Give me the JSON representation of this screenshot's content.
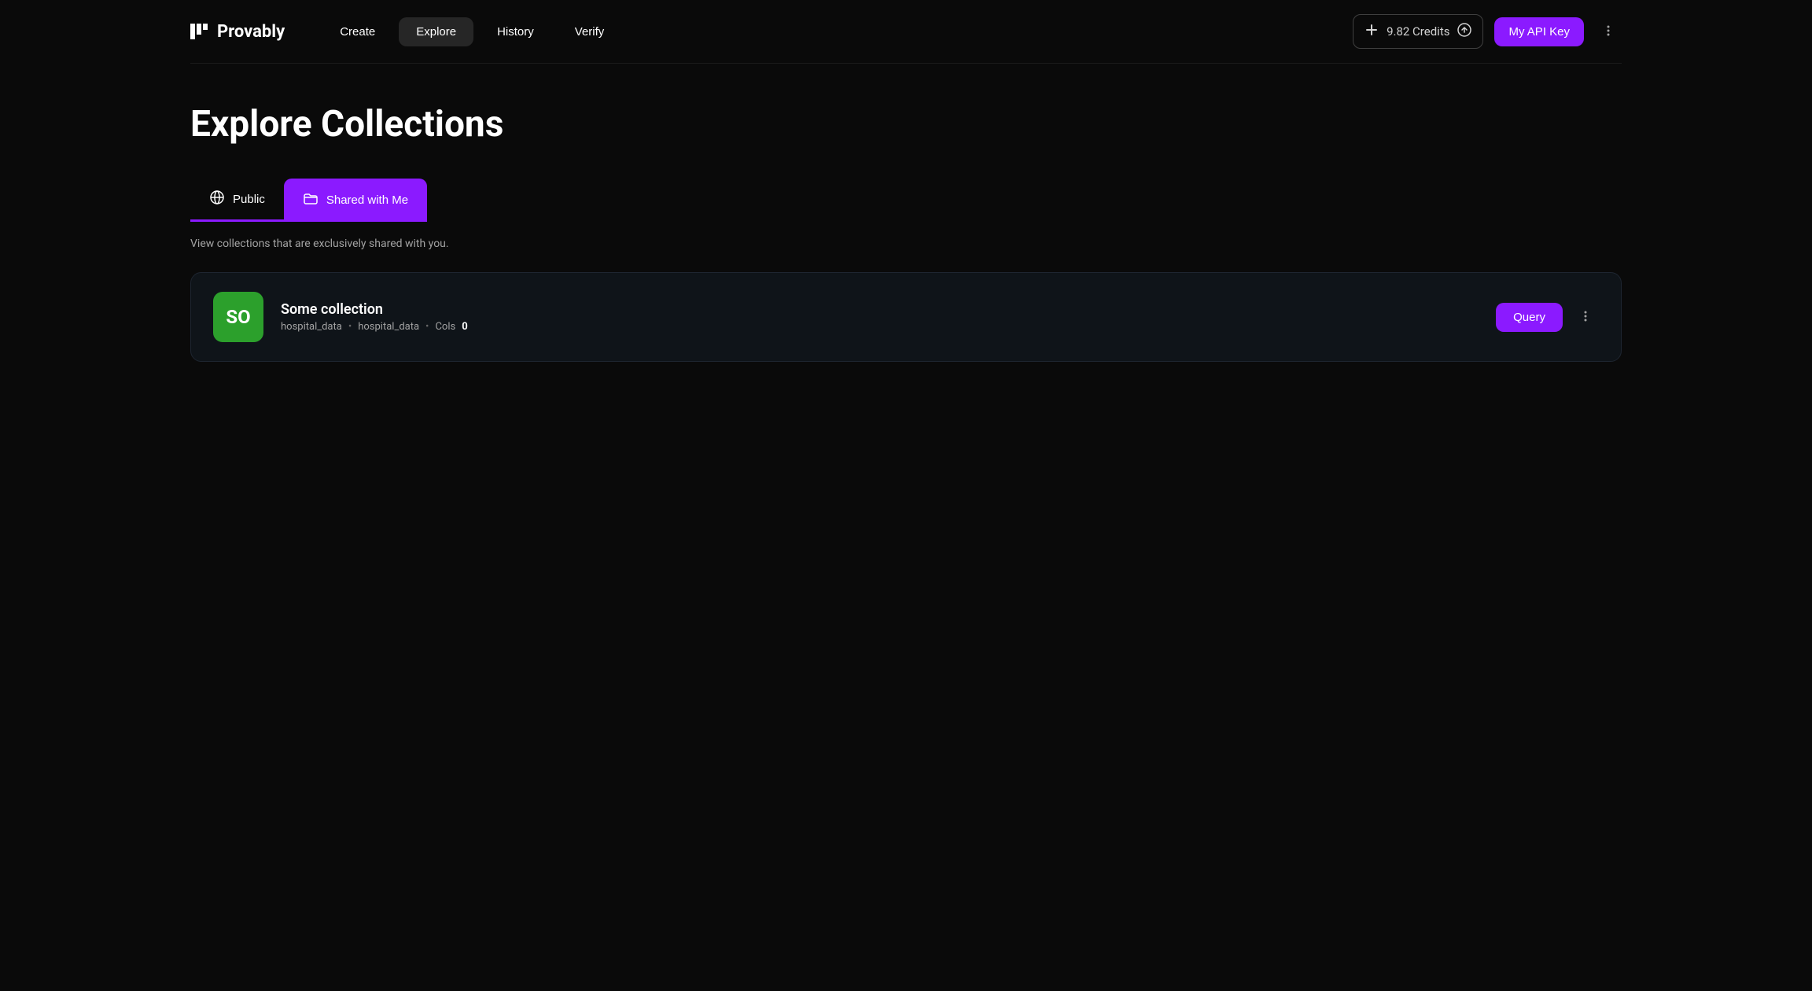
{
  "brand": "Provably",
  "nav": {
    "create": "Create",
    "explore": "Explore",
    "history": "History",
    "verify": "Verify"
  },
  "header": {
    "credits_label": "9.82 Credits",
    "api_key_label": "My API Key"
  },
  "page": {
    "title": "Explore Collections"
  },
  "tabs": {
    "public": "Public",
    "shared": "Shared with Me",
    "description": "View collections that are exclusively shared with you."
  },
  "collections": [
    {
      "avatar_text": "SO",
      "title": "Some collection",
      "meta_owner": "hospital_data",
      "meta_name": "hospital_data",
      "cols_label": "Cols",
      "cols_value": "0",
      "query_label": "Query"
    }
  ]
}
